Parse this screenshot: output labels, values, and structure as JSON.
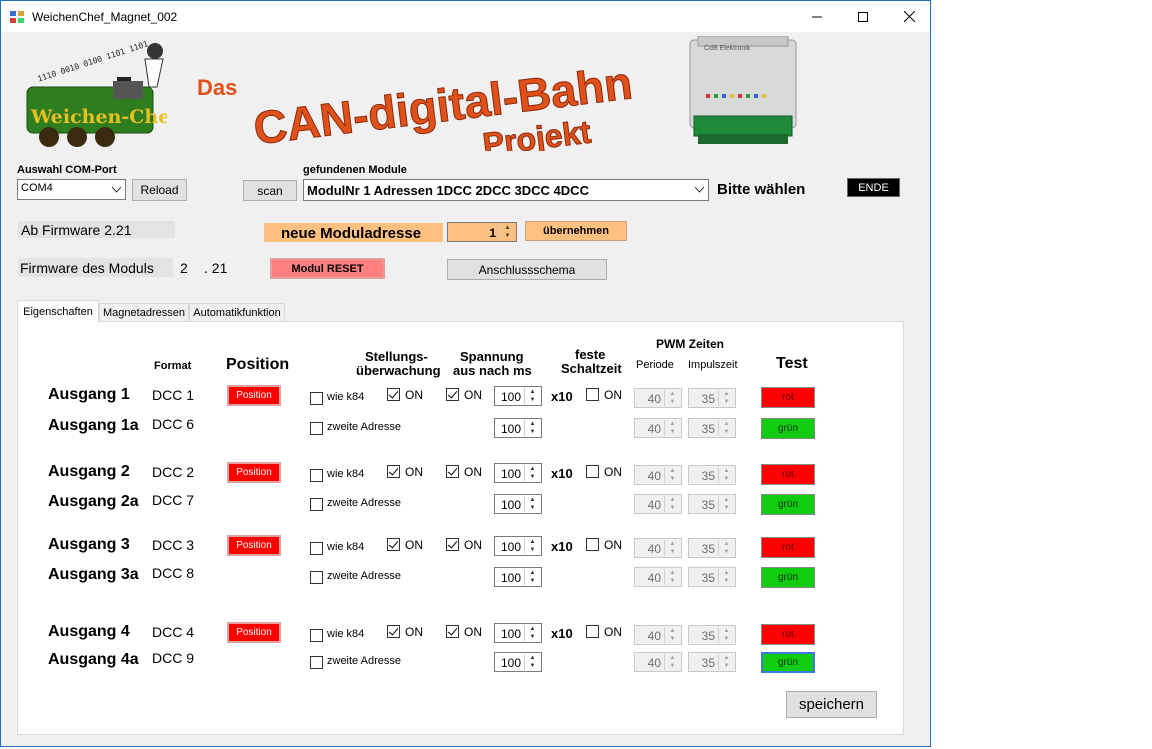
{
  "window": {
    "title": "WeichenChef_Magnet_002"
  },
  "logo": {
    "text": "Weichen-Chef",
    "binary": "1110 0010 0100 1101 1101"
  },
  "banner": {
    "line1": "Das",
    "line2": "CAN-digital-Bahn",
    "line3": "Projekt"
  },
  "device": {
    "brand": "CdB Elektronik"
  },
  "com": {
    "label": "Auswahl COM-Port",
    "value": "COM4",
    "reload": "Reload"
  },
  "scan": "scan",
  "module": {
    "label": "gefundenen Module",
    "value": "ModulNr 1 Adressen 1DCC 2DCC 3DCC 4DCC",
    "hint": "Bitte wählen"
  },
  "ende": "ENDE",
  "firmware": {
    "min": "Ab Firmware 2.21",
    "label": "Firmware des Moduls",
    "major": "2",
    "minor": ". 21"
  },
  "address": {
    "label": "neue Moduladresse",
    "value": "1",
    "apply": "übernehmen"
  },
  "reset": "Modul RESET",
  "schema": "Anschlussschema",
  "tabs": [
    "Eigenschaften",
    "Magnetadressen",
    "Automatikfunktion"
  ],
  "headers": {
    "format": "Format",
    "position": "Position",
    "stellung1": "Stellungs-",
    "stellung2": "überwachung",
    "spannung1": "Spannung",
    "spannung2": "aus nach ms",
    "feste1": "feste",
    "feste2": "Schaltzeit",
    "pwm": "PWM Zeiten",
    "periode": "Periode",
    "impuls": "Impulszeit",
    "test": "Test"
  },
  "common": {
    "position_btn": "Position",
    "on": "ON",
    "x10": "x10",
    "wie_k84": "wie k84",
    "zweite": "zweite Adresse",
    "rot": "rot",
    "gruen": "grün"
  },
  "outputs": [
    {
      "name": "Ausgang 1",
      "dcc": "DCC 1",
      "alt_name": "Ausgang 1a",
      "alt_dcc": "DCC 6",
      "ms": "100",
      "alt_ms": "100",
      "periode": "40",
      "impuls": "35",
      "alt_periode": "40",
      "alt_impuls": "35",
      "stellung_on": true,
      "spannung_on": true
    },
    {
      "name": "Ausgang 2",
      "dcc": "DCC 2",
      "alt_name": "Ausgang 2a",
      "alt_dcc": "DCC 7",
      "ms": "100",
      "alt_ms": "100",
      "periode": "40",
      "impuls": "35",
      "alt_periode": "40",
      "alt_impuls": "35",
      "stellung_on": true,
      "spannung_on": true
    },
    {
      "name": "Ausgang 3",
      "dcc": "DCC 3",
      "alt_name": "Ausgang 3a",
      "alt_dcc": "DCC 8",
      "ms": "100",
      "alt_ms": "100",
      "periode": "40",
      "impuls": "35",
      "alt_periode": "40",
      "alt_impuls": "35",
      "stellung_on": true,
      "spannung_on": true
    },
    {
      "name": "Ausgang 4",
      "dcc": "DCC 4",
      "alt_name": "Ausgang 4a",
      "alt_dcc": "DCC 9",
      "ms": "100",
      "alt_ms": "100",
      "periode": "40",
      "impuls": "35",
      "alt_periode": "40",
      "alt_impuls": "35",
      "stellung_on": true,
      "spannung_on": true
    }
  ],
  "save": "speichern",
  "colors": {
    "accent_orange": "#ffc080",
    "reset_red": "#ff8080",
    "test_red": "#ff0000",
    "test_green": "#11cc11",
    "title_blue": "#1e6fc2"
  }
}
